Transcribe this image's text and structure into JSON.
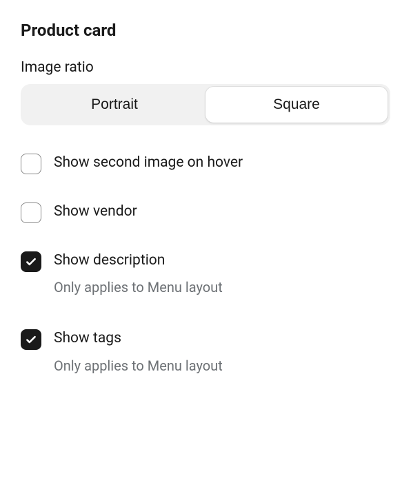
{
  "section": {
    "title": "Product card"
  },
  "imageRatio": {
    "label": "Image ratio",
    "options": {
      "portrait": "Portrait",
      "square": "Square"
    },
    "selected": "square"
  },
  "checkboxes": {
    "secondImage": {
      "label": "Show second image on hover",
      "checked": false
    },
    "vendor": {
      "label": "Show vendor",
      "checked": false
    },
    "description": {
      "label": "Show description",
      "help": "Only applies to Menu layout",
      "checked": true
    },
    "tags": {
      "label": "Show tags",
      "help": "Only applies to Menu layout",
      "checked": true
    }
  }
}
